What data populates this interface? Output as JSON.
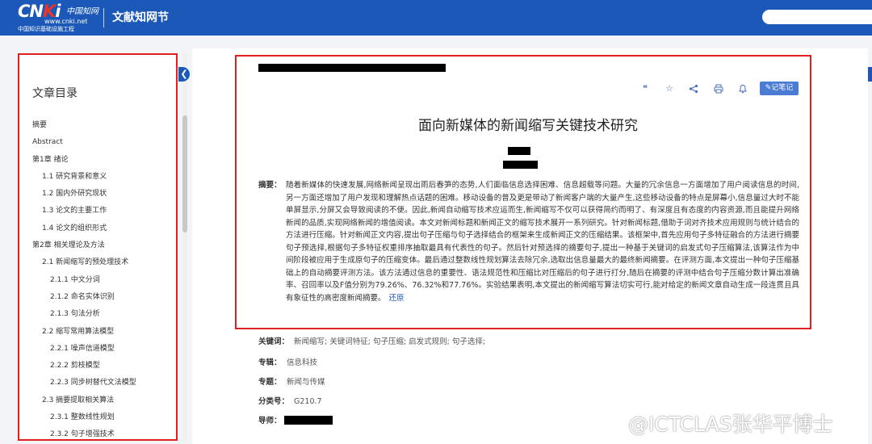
{
  "header": {
    "logo_mark_prefix": "CN",
    "logo_mark_k": "K",
    "logo_mark_suffix": "i",
    "logo_cn_name": "中国知网",
    "logo_url": "www.cnki.net",
    "logo_slogan": "中国知识基础设施工程",
    "title": "文献知网节"
  },
  "toc": {
    "title": "文章目录",
    "items": [
      {
        "level": 1,
        "label": "摘要"
      },
      {
        "level": 1,
        "label": "Abstract"
      },
      {
        "level": 1,
        "label": "第1章 绪论"
      },
      {
        "level": 2,
        "label": "1.1 研究背景和意义"
      },
      {
        "level": 2,
        "label": "1.2 国内外研究现状"
      },
      {
        "level": 2,
        "label": "1.3 论文的主要工作"
      },
      {
        "level": 2,
        "label": "1.4 论文的组织形式"
      },
      {
        "level": 1,
        "label": "第2章 相关理论及方法"
      },
      {
        "level": 2,
        "label": "2.1 新闻缩写的预处理技术"
      },
      {
        "level": 3,
        "label": "2.1.1 中文分词"
      },
      {
        "level": 3,
        "label": "2.1.2 命名实体识别"
      },
      {
        "level": 3,
        "label": "2.1.3 句法分析"
      },
      {
        "level": 2,
        "label": "2.2 缩写常用算法模型"
      },
      {
        "level": 3,
        "label": "2.2.1 噪声信道模型"
      },
      {
        "level": 3,
        "label": "2.2.2 剪枝模型"
      },
      {
        "level": 3,
        "label": "2.2.3 同步树替代文法模型"
      },
      {
        "level": 2,
        "label": "2.3 摘要提取相关算法"
      },
      {
        "level": 3,
        "label": "2.3.1 整数线性规划"
      },
      {
        "level": 3,
        "label": "2.3.2 句子增强技术"
      }
    ]
  },
  "toolbar": {
    "items": [
      {
        "name": "quote",
        "icon": "quote-icon"
      },
      {
        "name": "favorite",
        "icon": "star-icon"
      },
      {
        "name": "share",
        "icon": "share-icon"
      },
      {
        "name": "print",
        "icon": "printer-icon"
      },
      {
        "name": "notify",
        "icon": "bell-icon"
      }
    ],
    "note_label": "记笔记",
    "note_icon": "pencil-icon"
  },
  "article": {
    "title": "面向新媒体的新闻缩写关键技术研究",
    "abstract_label": "摘要：",
    "abstract": "随着新媒体的快速发展,网络新闻呈现出雨后春笋的态势,人们面临信息选择困难、信息超载等问题。大量的冗余信息一方面增加了用户阅读信息的时间,另一方面还增加了用户发现和理解热点话题的困难。移动设备的普及更是带动了新闻客户端的大量产生,这些移动设备的特点是屏幕小,信息量过大时不能单屏显示,分屏又会导致阅读的不便。因此,新闻自动缩写技术应运而生,新闻缩写不仅可以获得简约而明了、有深度且有态度的内容资源,而且能提升网络新闻的品质,实现网络新闻的增值阅读。本文对新闻标题和新闻正文的缩写技术展开一系列研究。针对新闻标题,借助于词对齐技术应用规则与统计结合的方法进行压缩。针对新闻正文内容,提出句子压缩与句子选择结合的框架来生成新闻正文的压缩结果。该框架中,首先应用句子多特征融合的方法进行摘要句子预选择,根据句子多特征权重排序抽取最具有代表性的句子。然后针对预选择的摘要句子,提出一种基于关键词的启发式句子压缩算法,该算法作为中间阶段被应用于生成原句子的压缩变体。最后通过整数线性规划算法去除冗余,选取出信息量最大的最终新闻摘要。在评测方面,本文提出一种句子压缩基础上的自动摘要评测方法。该方法通过信息的重要性、语法规范性和压缩比对压缩后的句子进行打分,随后在摘要的评测中结合句子压缩分数计算出准确率、召回率以及F值分别为79.26%、76.32%和77.76%。实验结果表明,本文提出的新闻缩写算法切实可行,能对给定的新闻文章自动生成一段连贯且具有象征性的高密度新闻摘要。",
    "restore_label": "还原",
    "meta": [
      {
        "label": "关键词：",
        "value": "新闻缩写;  关键词特征;  句子压缩;  启发式规则;  句子选择;"
      },
      {
        "label": "专辑：",
        "value": "信息科技"
      },
      {
        "label": "专题：",
        "value": "新闻与传媒"
      },
      {
        "label": "分类号：",
        "value": "G210.7"
      },
      {
        "label": "导师：",
        "value": ""
      }
    ]
  },
  "watermark": {
    "text": "@ICTCLAS张华平博士"
  },
  "colors": {
    "brand": "#1b58b8",
    "highlight_border": "#e02020",
    "link": "#1b58b8"
  }
}
